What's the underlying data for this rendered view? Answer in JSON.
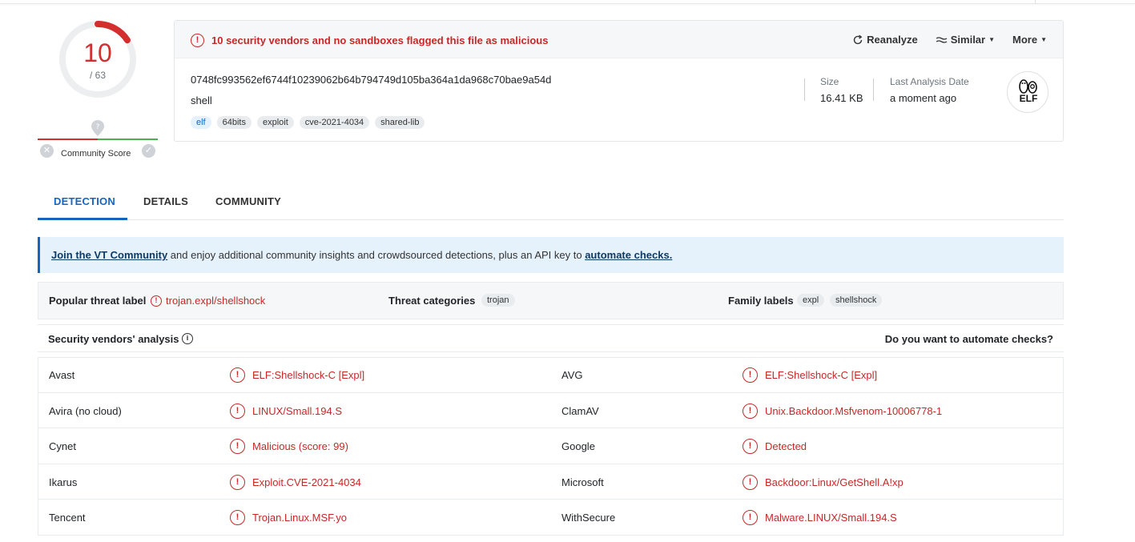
{
  "score": {
    "detections": "10",
    "total": "/ 63",
    "fraction": 0.1587,
    "color": "#d32f2f"
  },
  "community": {
    "label": "Community Score"
  },
  "header": {
    "alert": "10 security vendors and no sandboxes flagged this file as malicious",
    "reanalyze": "Reanalyze",
    "similar": "Similar",
    "more": "More"
  },
  "file": {
    "hash": "0748fc993562ef6744f10239062b64b794749d105ba364a1da968c70bae9a54d",
    "name": "shell",
    "tags": [
      "elf",
      "64bits",
      "exploit",
      "cve-2021-4034",
      "shared-lib"
    ],
    "size_label": "Size",
    "size_value": "16.41 KB",
    "last_analysis_label": "Last Analysis Date",
    "last_analysis_value": "a moment ago",
    "type_badge": "ELF"
  },
  "tabs": [
    "DETECTION",
    "DETAILS",
    "COMMUNITY"
  ],
  "banner": {
    "link1": "Join the VT Community",
    "middle": " and enjoy additional community insights and crowdsourced detections, plus an API key to ",
    "link2": "automate checks."
  },
  "threat": {
    "popular_label": "Popular threat label",
    "popular_value": "trojan.expl/shellshock",
    "categories_label": "Threat categories",
    "categories": [
      "trojan"
    ],
    "family_label": "Family labels",
    "families": [
      "expl",
      "shellshock"
    ]
  },
  "vendors": {
    "title": "Security vendors' analysis",
    "automate": "Do you want to automate checks?",
    "rows": [
      {
        "left_name": "Avast",
        "left_result": "ELF:Shellshock-C [Expl]",
        "right_name": "AVG",
        "right_result": "ELF:Shellshock-C [Expl]"
      },
      {
        "left_name": "Avira (no cloud)",
        "left_result": "LINUX/Small.194.S",
        "right_name": "ClamAV",
        "right_result": "Unix.Backdoor.Msfvenom-10006778-1"
      },
      {
        "left_name": "Cynet",
        "left_result": "Malicious (score: 99)",
        "right_name": "Google",
        "right_result": "Detected"
      },
      {
        "left_name": "Ikarus",
        "left_result": "Exploit.CVE-2021-4034",
        "right_name": "Microsoft",
        "right_result": "Backdoor:Linux/GetShell.A!xp"
      },
      {
        "left_name": "Tencent",
        "left_result": "Trojan.Linux.MSF.yo",
        "right_name": "WithSecure",
        "right_result": "Malware.LINUX/Small.194.S"
      }
    ]
  },
  "colors": {
    "malicious": "#c62828",
    "accent": "#1565c0"
  }
}
